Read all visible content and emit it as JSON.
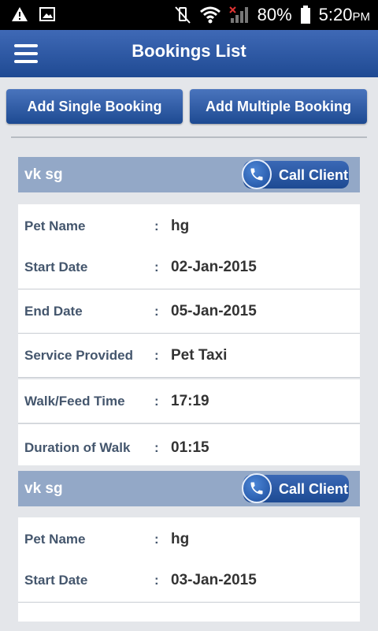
{
  "status_bar": {
    "battery": "80%",
    "time": "5:20",
    "ampm": "PM"
  },
  "app_bar": {
    "title": "Bookings List"
  },
  "buttons": {
    "add_single": "Add Single Booking",
    "add_multiple": "Add Multiple Booking"
  },
  "labels": {
    "colon": ":",
    "call_client": "Call Client"
  },
  "bookings": [
    {
      "client_name": "vk sg",
      "fields": [
        {
          "label": "Pet Name",
          "value": "hg"
        },
        {
          "label": "Start Date",
          "value": "02-Jan-2015"
        },
        {
          "label": "End Date",
          "value": "05-Jan-2015"
        },
        {
          "label": "Service Provided",
          "value": "Pet Taxi"
        },
        {
          "label": "Walk/Feed Time",
          "value": "17:19"
        },
        {
          "label": "Duration of Walk",
          "value": "01:15"
        }
      ]
    },
    {
      "client_name": "vk sg",
      "fields": [
        {
          "label": "Pet Name",
          "value": "hg"
        },
        {
          "label": "Start Date",
          "value": "03-Jan-2015"
        }
      ]
    }
  ]
}
